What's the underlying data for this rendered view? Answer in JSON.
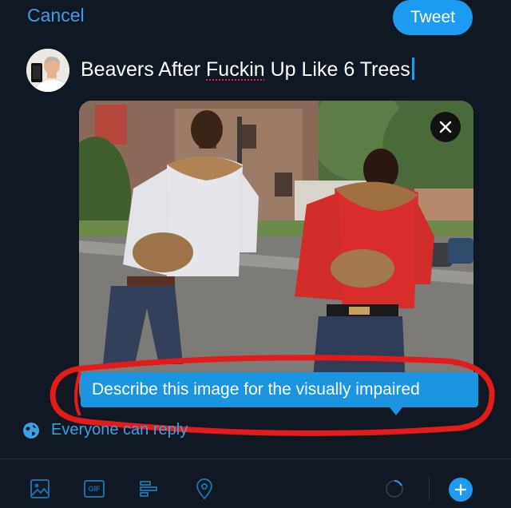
{
  "header": {
    "cancel_label": "Cancel",
    "tweet_label": "Tweet"
  },
  "compose": {
    "text_before": "Beavers After ",
    "misspelled_word": "Fuckin",
    "text_after": " Up Like 6 Trees"
  },
  "media": {
    "alt_text_prompt": "Describe this image for the visually impaired"
  },
  "reply_setting": {
    "label": "Everyone can reply"
  },
  "toolbar": {
    "gif_label": "GIF",
    "icons": [
      "image-icon",
      "gif-icon",
      "poll-icon",
      "location-icon",
      "character-count-ring",
      "add-thread-icon"
    ]
  },
  "colors": {
    "background": "#0f1823",
    "accent": "#1d9bf0",
    "link": "#3ba0e6",
    "highlight_ring": "#e41b1b",
    "spellcheck": "#e0245e"
  }
}
